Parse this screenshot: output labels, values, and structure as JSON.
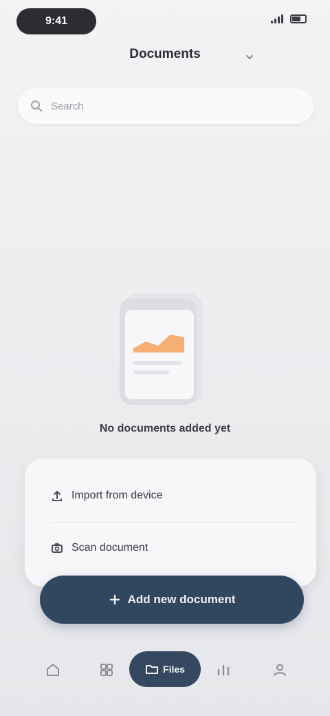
{
  "status_bar": {
    "time": "9:41",
    "icons": [
      "signal-icon",
      "battery-icon"
    ]
  },
  "header": {
    "title": "Documents",
    "chevron_icon": "chevron-down-icon"
  },
  "search": {
    "placeholder": "Search",
    "icon": "search-icon"
  },
  "empty_state": {
    "illustration": "document-icon",
    "message": "No documents added yet",
    "accent_color": "#f4a15c"
  },
  "sheet": {
    "options": [
      {
        "label": "Import from device",
        "icon": "upload-icon"
      },
      {
        "label": "Scan document",
        "icon": "camera-icon"
      }
    ]
  },
  "primary_button": {
    "label": "Add new document",
    "icon": "plus-icon",
    "color": "#314760"
  },
  "bottom_nav": {
    "items": [
      {
        "icon": "home-icon"
      },
      {
        "icon": "grid-icon"
      },
      {
        "label": "Files",
        "icon": "folder-icon",
        "active": true
      },
      {
        "icon": "chart-icon"
      },
      {
        "icon": "user-icon"
      }
    ]
  }
}
